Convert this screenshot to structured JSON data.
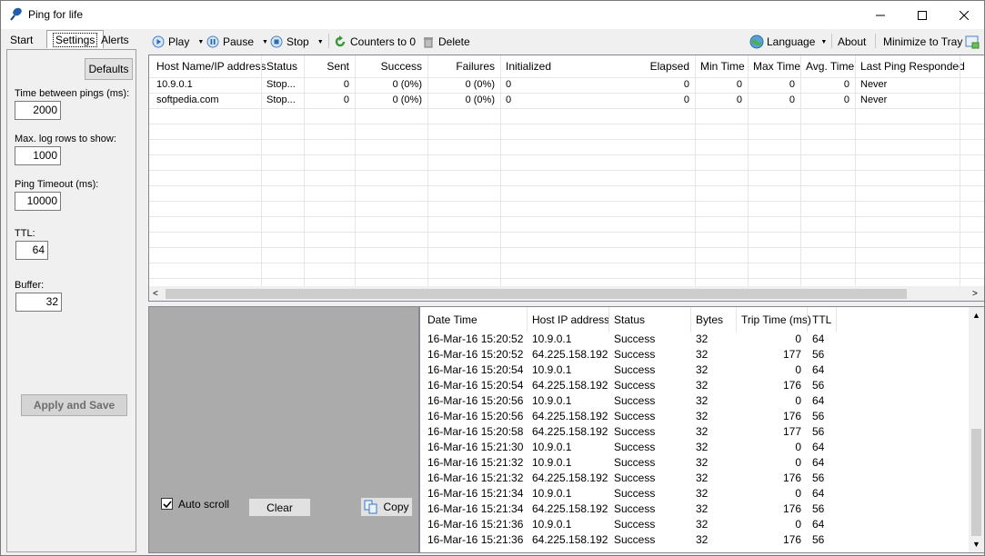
{
  "window": {
    "title": "Ping for life"
  },
  "left_tabs": [
    "Start",
    "Settings",
    "Alerts"
  ],
  "settings": {
    "defaults_label": "Defaults",
    "time_between_pings_label": "Time between pings (ms):",
    "time_between_pings": "2000",
    "max_log_rows_label": "Max. log rows to show:",
    "max_log_rows": "1000",
    "ping_timeout_label": "Ping Timeout (ms):",
    "ping_timeout": "10000",
    "ttl_label": "TTL:",
    "ttl": "64",
    "buffer_label": "Buffer:",
    "buffer": "32",
    "apply_label": "Apply and Save"
  },
  "toolbar": {
    "play": "Play",
    "pause": "Pause",
    "stop": "Stop",
    "counters": "Counters to 0",
    "delete": "Delete",
    "language": "Language",
    "about": "About",
    "minimize": "Minimize to Tray"
  },
  "hosts": {
    "columns": [
      "Host Name/IP address",
      "Status",
      "Sent",
      "Success",
      "Failures",
      "Initialized",
      "Elapsed",
      "Min Time",
      "Max Time",
      "Avg. Time",
      "Last Ping Responded"
    ],
    "rows": [
      [
        "10.9.0.1",
        "Stop...",
        "0",
        "0 (0%)",
        "0 (0%)",
        "0",
        "0",
        "0",
        "0",
        "0",
        "Never"
      ],
      [
        "softpedia.com",
        "Stop...",
        "0",
        "0 (0%)",
        "0 (0%)",
        "0",
        "0",
        "0",
        "0",
        "0",
        "Never"
      ]
    ]
  },
  "log_panel": {
    "auto_scroll_label": "Auto scroll",
    "auto_scroll_checked": true,
    "clear_label": "Clear",
    "copy_label": "Copy"
  },
  "log": {
    "columns": [
      "Date Time",
      "Host IP address",
      "Status",
      "Bytes",
      "Trip Time (ms)",
      "TTL"
    ],
    "rows": [
      [
        "16-Mar-16 15:20:52",
        "10.9.0.1",
        "Success",
        "32",
        "0",
        "64"
      ],
      [
        "16-Mar-16 15:20:52",
        "64.225.158.192",
        "Success",
        "32",
        "177",
        "56"
      ],
      [
        "16-Mar-16 15:20:54",
        "10.9.0.1",
        "Success",
        "32",
        "0",
        "64"
      ],
      [
        "16-Mar-16 15:20:54",
        "64.225.158.192",
        "Success",
        "32",
        "176",
        "56"
      ],
      [
        "16-Mar-16 15:20:56",
        "10.9.0.1",
        "Success",
        "32",
        "0",
        "64"
      ],
      [
        "16-Mar-16 15:20:56",
        "64.225.158.192",
        "Success",
        "32",
        "176",
        "56"
      ],
      [
        "16-Mar-16 15:20:58",
        "64.225.158.192",
        "Success",
        "32",
        "177",
        "56"
      ],
      [
        "16-Mar-16 15:21:30",
        "10.9.0.1",
        "Success",
        "32",
        "0",
        "64"
      ],
      [
        "16-Mar-16 15:21:32",
        "10.9.0.1",
        "Success",
        "32",
        "0",
        "64"
      ],
      [
        "16-Mar-16 15:21:32",
        "64.225.158.192",
        "Success",
        "32",
        "176",
        "56"
      ],
      [
        "16-Mar-16 15:21:34",
        "10.9.0.1",
        "Success",
        "32",
        "0",
        "64"
      ],
      [
        "16-Mar-16 15:21:34",
        "64.225.158.192",
        "Success",
        "32",
        "176",
        "56"
      ],
      [
        "16-Mar-16 15:21:36",
        "10.9.0.1",
        "Success",
        "32",
        "0",
        "64"
      ],
      [
        "16-Mar-16 15:21:36",
        "64.225.158.192",
        "Success",
        "32",
        "176",
        "56"
      ]
    ]
  },
  "colors": {
    "panel_bg": "#f0f0f0",
    "grid_bg": "#ffffff",
    "log_left_bg": "#ababab",
    "accent_blue": "#2b6ab5",
    "green": "#3a9a3a"
  }
}
